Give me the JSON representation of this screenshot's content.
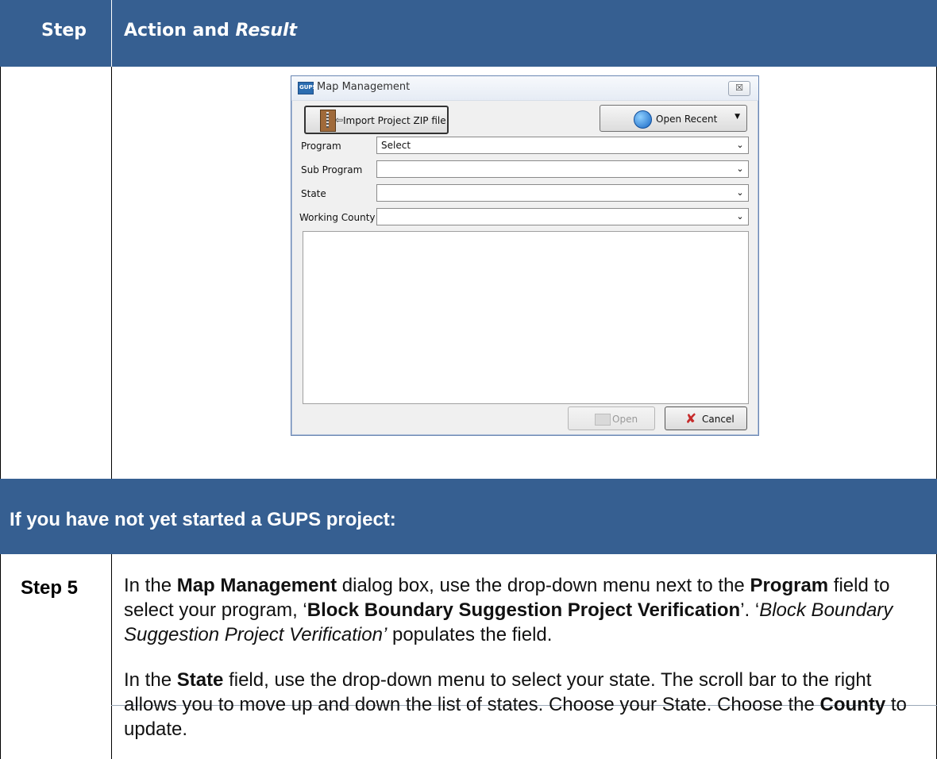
{
  "table": {
    "header": {
      "step": "Step",
      "action_prefix": "Action and ",
      "action_italic": "Result"
    },
    "section_heading": "If you have not yet started a GUPS project:",
    "step5": {
      "label": "Step 5",
      "p1": [
        {
          "t": "In the ",
          "s": "n"
        },
        {
          "t": "Map Management",
          "s": "b"
        },
        {
          "t": " dialog box, use the drop-down menu next to the ",
          "s": "n"
        },
        {
          "t": "Program",
          "s": "b"
        },
        {
          "t": " field to select your program, ‘",
          "s": "n"
        },
        {
          "t": "Block Boundary Suggestion Project Verification",
          "s": "b"
        },
        {
          "t": "’. ‘",
          "s": "n"
        },
        {
          "t": "Block Boundary Suggestion Project Verification’",
          "s": "i"
        },
        {
          "t": " populates the field.",
          "s": "n"
        }
      ],
      "p2": [
        {
          "t": "In the ",
          "s": "n"
        },
        {
          "t": "State",
          "s": "b"
        },
        {
          "t": " field, use the drop-down menu to select your state. The scroll bar to the right allows you to move up and down the list of states. Choose your State. Choose the ",
          "s": "n"
        },
        {
          "t": "County",
          "s": "b"
        },
        {
          "t": " to update.",
          "s": "n"
        }
      ]
    }
  },
  "dialog": {
    "app_icon_text": "GUPS",
    "title": "Map Management",
    "close_glyph": "☒",
    "import_label": "Import Project ZIP file",
    "recent_label": "Open Recent",
    "recent_caret": "▼",
    "fields": {
      "program": {
        "label": "Program",
        "value": "Select"
      },
      "sub_program": {
        "label": "Sub Program",
        "value": ""
      },
      "state": {
        "label": "State",
        "value": ""
      },
      "working_county": {
        "label": "Working County",
        "value": ""
      }
    },
    "dropdown_glyph": "⌄",
    "open_label": "Open",
    "cancel_label": "Cancel",
    "cancel_glyph": "✘"
  }
}
